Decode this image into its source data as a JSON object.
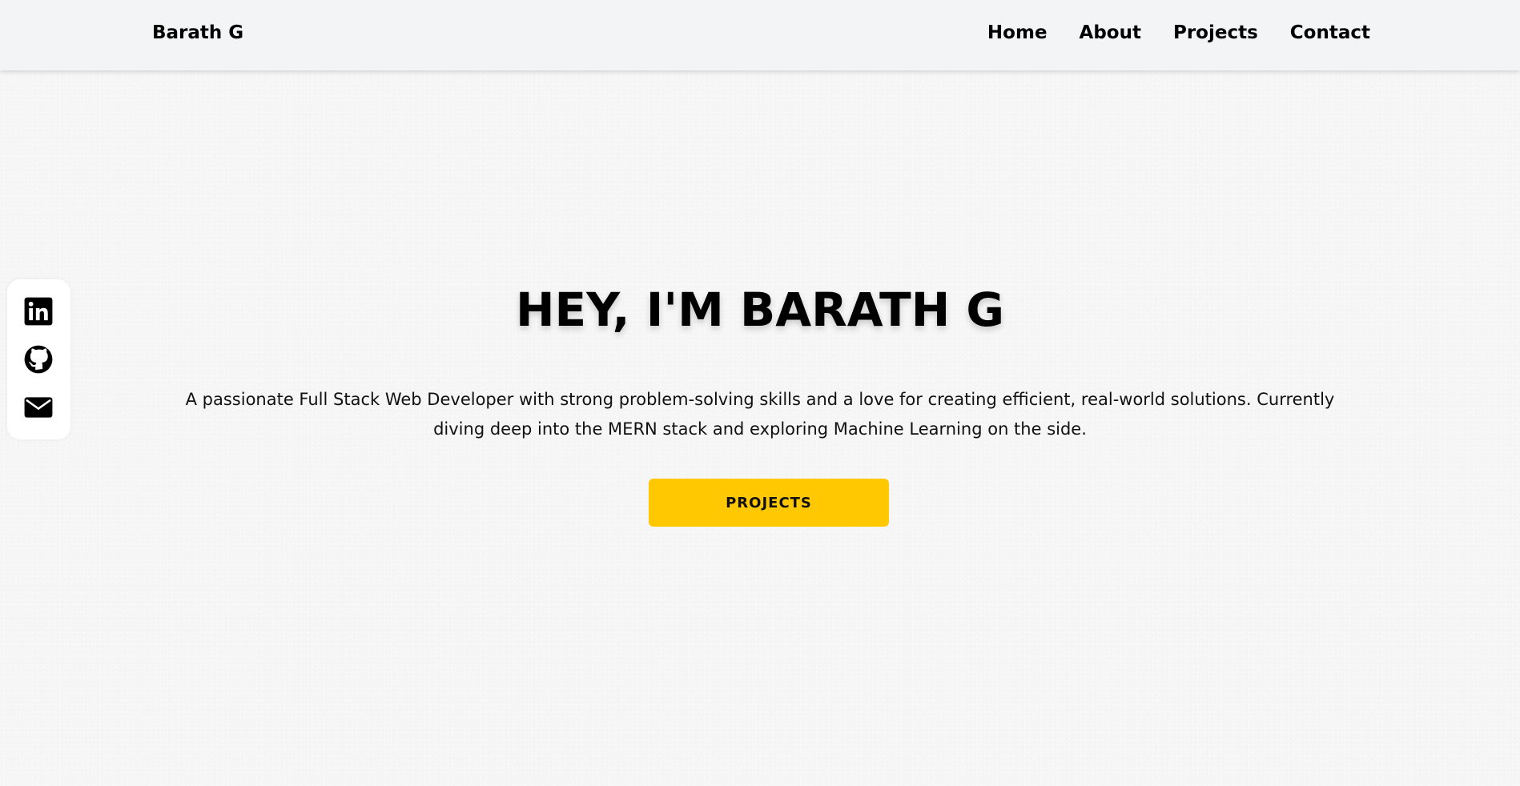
{
  "navbar": {
    "brand": "Barath G",
    "links": [
      {
        "label": "Home"
      },
      {
        "label": "About"
      },
      {
        "label": "Projects"
      },
      {
        "label": "Contact"
      }
    ]
  },
  "social": {
    "icons": [
      "linkedin-icon",
      "github-icon",
      "mail-icon"
    ]
  },
  "hero": {
    "title": "HEY, I'M BARATH G",
    "description": "A passionate Full Stack Web Developer with strong problem-solving skills and a love for creating efficient, real-world solutions. Currently diving deep into the MERN stack and exploring Machine Learning on the side.",
    "cta_label": "PROJECTS"
  },
  "colors": {
    "accent": "#ffc800",
    "navbar_bg": "#f3f4f6",
    "page_bg": "#f6f6f6"
  }
}
